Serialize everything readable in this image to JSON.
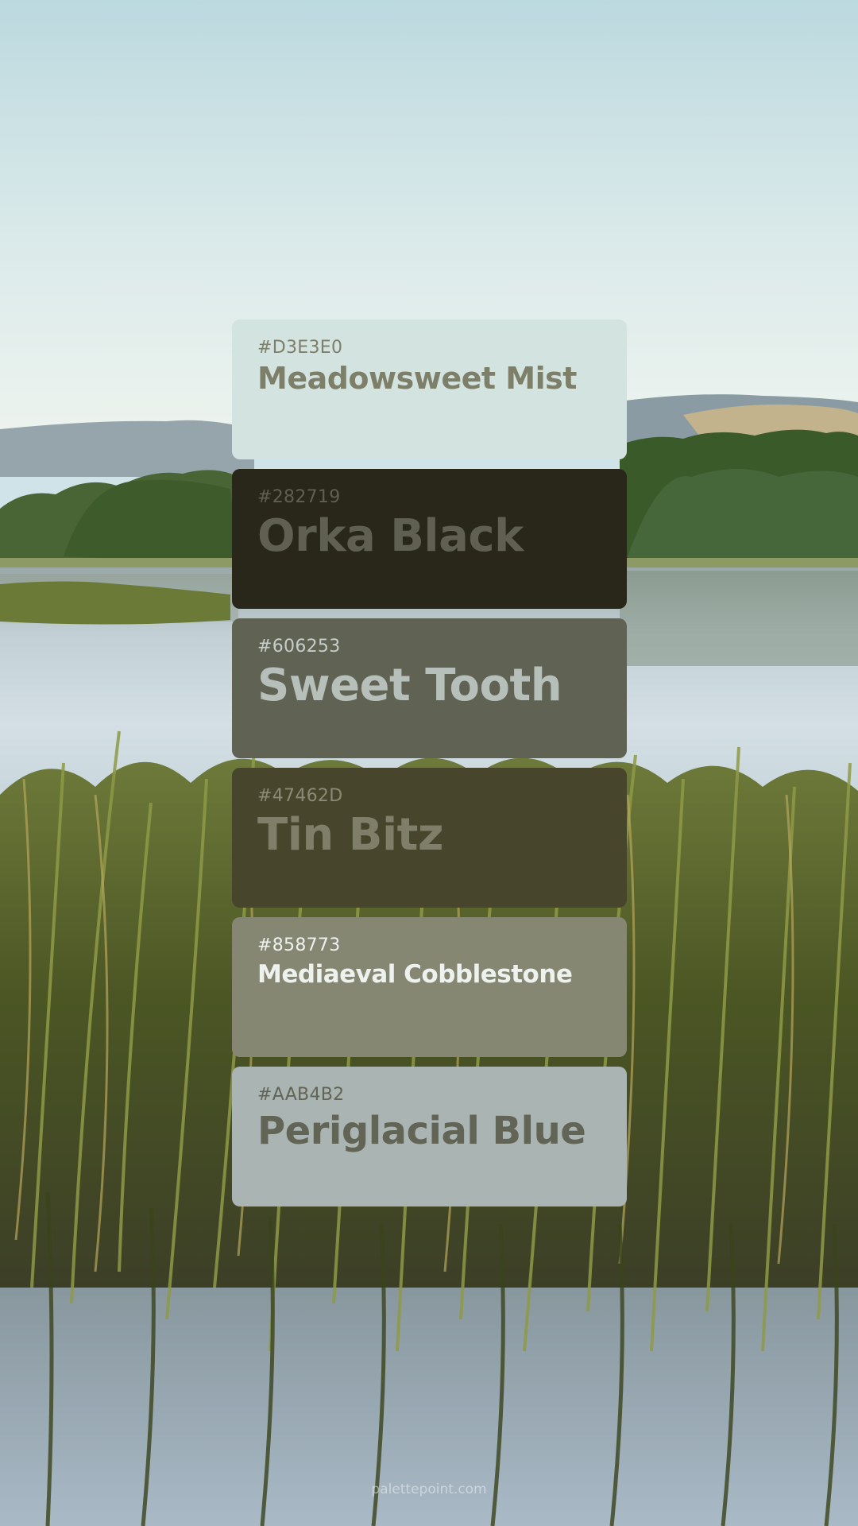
{
  "palette": [
    {
      "hex": "#D3E3E0",
      "name": "Meadowsweet Mist"
    },
    {
      "hex": "#282719",
      "name": "Orka Black"
    },
    {
      "hex": "#606253",
      "name": "Sweet Tooth"
    },
    {
      "hex": "#47462D",
      "name": "Tin Bitz"
    },
    {
      "hex": "#858773",
      "name": "Mediaeval Cobblestone"
    },
    {
      "hex": "#AAB4B2",
      "name": "Periglacial Blue"
    }
  ],
  "footer": {
    "credit": "palettepoint.com"
  },
  "background": {
    "description_icon": "lake-landscape-photo",
    "colors": {
      "sky_top": "#bcd9df",
      "sky_horizon": "#eef4ef",
      "hills": "#8e9ea4",
      "forest": "#3d5a2c",
      "water": "#c9d7dd",
      "reeds": "#5d6b2d"
    }
  }
}
